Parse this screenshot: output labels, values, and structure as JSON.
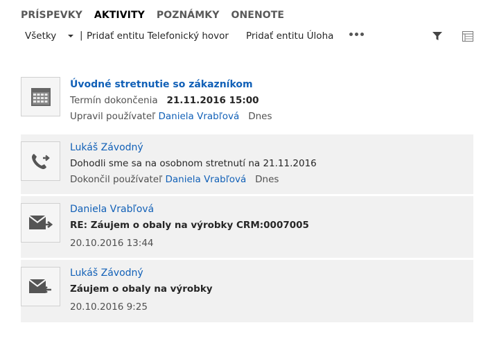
{
  "tabs": [
    {
      "label": "PRÍSPEVKY",
      "active": false
    },
    {
      "label": "AKTIVITY",
      "active": true
    },
    {
      "label": "POZNÁMKY",
      "active": false
    },
    {
      "label": "ONENOTE",
      "active": false
    }
  ],
  "toolbar": {
    "filter_value": "Všetky",
    "separator": "|",
    "add_phone_call": "Pridať entitu Telefonický hovor",
    "add_task": "Pridať entitu Úloha",
    "more_icon": "more-dots-icon",
    "filter_icon": "funnel-icon",
    "view_icon": "grid-view-icon"
  },
  "activities": [
    {
      "icon": "calendar-icon",
      "title": "Úvodné stretnutie so zákazníkom",
      "detail_label": "Termín dokončenia",
      "detail_value": "21.11.2016 15:00",
      "meta_label": "Upravil používateľ",
      "meta_user": "Daniela Vrabľová",
      "meta_when": "Dnes"
    },
    {
      "icon": "phone-call-icon",
      "name": "Lukáš Závodný",
      "subject": "Dohodli sme sa na osobnom stretnutí na 21.11.2016",
      "meta_label": "Dokončil používateľ",
      "meta_user": "Daniela Vrabľová",
      "meta_when": "Dnes"
    },
    {
      "icon": "email-outgoing-icon",
      "name": "Daniela Vrabľová",
      "subject": "RE: Záujem o obaly na výrobky CRM:0007005",
      "date": "20.10.2016 13:44"
    },
    {
      "icon": "email-incoming-icon",
      "name": "Lukáš Závodný",
      "subject": "Záujem o obaly na výrobky",
      "date": "20.10.2016 9:25"
    }
  ]
}
